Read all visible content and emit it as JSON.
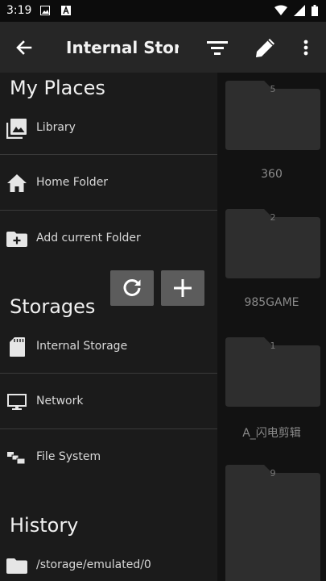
{
  "status_bar": {
    "time": "3:19"
  },
  "app_bar": {
    "title": "Internal Stor..."
  },
  "drawer": {
    "my_places_title": "My Places",
    "my_places": [
      {
        "label": "Library",
        "icon": "photo-library-icon"
      },
      {
        "label": "Home Folder",
        "icon": "home-icon"
      },
      {
        "label": "Add current Folder",
        "icon": "add-folder-icon"
      }
    ],
    "storages_title": "Storages",
    "storages": [
      {
        "label": "Internal Storage",
        "icon": "sd-card-icon"
      },
      {
        "label": "Network",
        "icon": "monitor-icon"
      },
      {
        "label": "File System",
        "icon": "file-system-icon"
      }
    ],
    "history_title": "History",
    "history": [
      {
        "label": "/storage/emulated/0",
        "icon": "folder-icon"
      }
    ]
  },
  "folders": [
    {
      "count": "5",
      "name": "360"
    },
    {
      "count": "2",
      "name": "985GAME"
    },
    {
      "count": "1",
      "name": "A_闪电剪辑"
    },
    {
      "count": "9",
      "name": ""
    }
  ],
  "colors": {
    "app_bar": "#262626",
    "drawer": "#1b1b1b",
    "folder": "#2e2e2e",
    "action_button": "#5c5c5c"
  }
}
